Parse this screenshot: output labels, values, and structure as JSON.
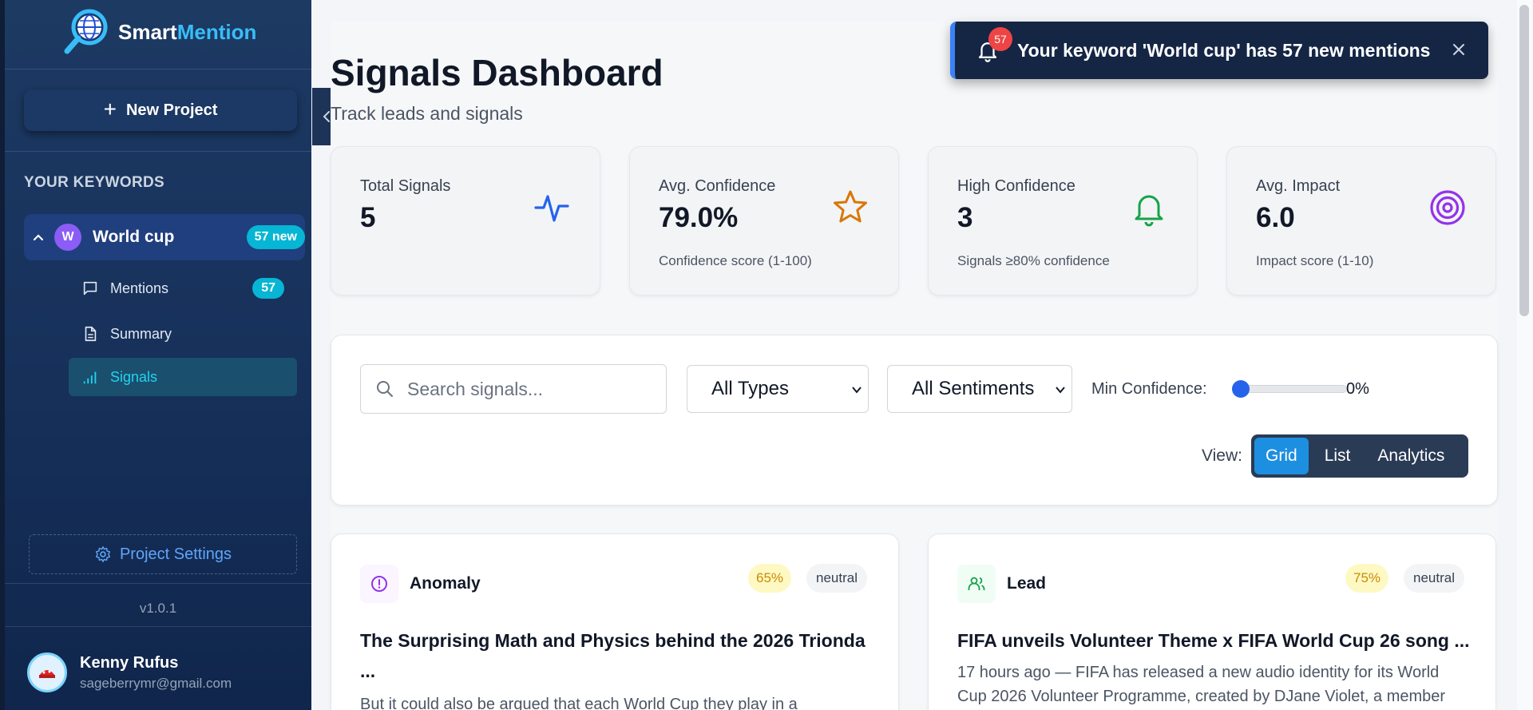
{
  "sidebar": {
    "brand_part1": "Smart",
    "brand_part2": "Mention",
    "new_project": "New Project",
    "keywords_heading": "YOUR KEYWORDS",
    "keyword": {
      "initial": "W",
      "name": "World cup",
      "badge": "57 new"
    },
    "sub_items": [
      {
        "label": "Mentions",
        "badge": "57",
        "icon": "message-square-icon"
      },
      {
        "label": "Summary",
        "icon": "file-text-icon"
      },
      {
        "label": "Signals",
        "icon": "signal-bars-icon",
        "active": true
      }
    ],
    "project_settings": "Project Settings",
    "version": "v1.0.1",
    "user": {
      "name": "Kenny Rufus",
      "email": "sageberrymr@gmail.com"
    }
  },
  "header": {
    "title": "Signals Dashboard",
    "subtitle": "Track leads and signals"
  },
  "stats": [
    {
      "label": "Total Signals",
      "value": "5",
      "note": "",
      "icon": "activity-icon",
      "color": "#2563eb"
    },
    {
      "label": "Avg. Confidence",
      "value": "79.0%",
      "note": "Confidence score (1-100)",
      "icon": "star-icon",
      "color": "#d97706"
    },
    {
      "label": "High Confidence",
      "value": "3",
      "note": "Signals ≥80% confidence",
      "icon": "bell-icon",
      "color": "#16a34a"
    },
    {
      "label": "Avg. Impact",
      "value": "6.0",
      "note": "Impact score (1-10)",
      "icon": "target-icon",
      "color": "#9333ea"
    }
  ],
  "filters": {
    "search_placeholder": "Search signals...",
    "type_select": "All Types",
    "sentiment_select": "All Sentiments",
    "min_confidence_label": "Min Confidence:",
    "min_confidence_value": 0,
    "min_confidence_display": "0%",
    "view_label": "View:",
    "view_options": [
      "Grid",
      "List",
      "Analytics"
    ],
    "active_view": "Grid"
  },
  "signals": [
    {
      "type": "Anomaly",
      "confidence": "65%",
      "sentiment": "neutral",
      "title": "The Surprising Math and Physics behind the 2026 Trionda ...",
      "description": "But it could also be argued that each World Cup they play in a",
      "icon": "alert-circle-icon"
    },
    {
      "type": "Lead",
      "confidence": "75%",
      "sentiment": "neutral",
      "title": "FIFA unveils Volunteer Theme x FIFA World Cup 26 song ...",
      "description": "17 hours ago — FIFA has released a new audio identity for its World Cup 2026 Volunteer Programme, created by DJane Violet, a member",
      "icon": "users-icon"
    }
  ],
  "toast": {
    "count": "57",
    "message": "Your keyword 'World cup' has 57 new mentions"
  },
  "colors": {
    "sidebar_bg": "#16305a",
    "accent": "#06b6d4",
    "primary": "#1d8fe0"
  }
}
